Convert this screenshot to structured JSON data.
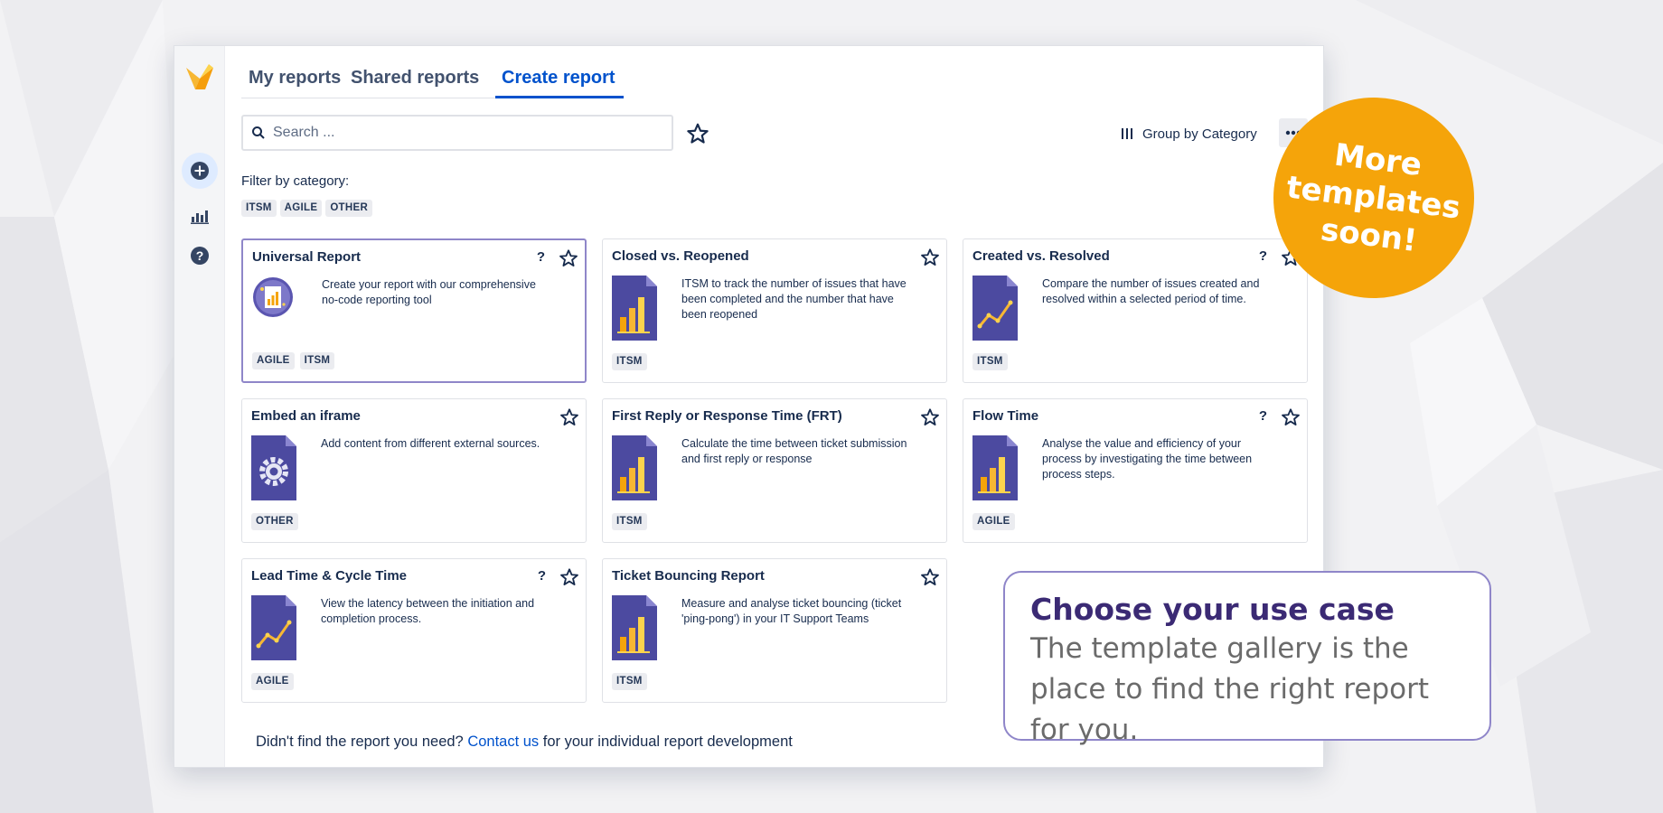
{
  "tabs": [
    {
      "label": "My reports",
      "active": false
    },
    {
      "label": "Shared reports",
      "active": false
    },
    {
      "label": "Create report",
      "active": true
    }
  ],
  "search": {
    "placeholder": "Search ...",
    "value": ""
  },
  "toolbar": {
    "group_label": "Group by Category",
    "more_icon": "more-icon"
  },
  "filter": {
    "label": "Filter by category:",
    "tags": [
      "ITSM",
      "AGILE",
      "OTHER"
    ]
  },
  "cards": [
    {
      "title": "Universal Report",
      "help": "?",
      "description": "Create your report with our comprehensive no-code reporting tool",
      "tags": [
        "AGILE",
        "ITSM"
      ],
      "icon": "universal-report-icon"
    },
    {
      "title": "Closed vs. Reopened",
      "help": "",
      "description": "ITSM to track the number of issues that have been completed and the number that have been reopened",
      "tags": [
        "ITSM"
      ],
      "icon": "bar-chart-doc-icon"
    },
    {
      "title": "Created vs. Resolved",
      "help": "?",
      "description": "Compare the number of issues created and resolved within a selected period of time.",
      "tags": [
        "ITSM"
      ],
      "icon": "line-chart-doc-icon"
    },
    {
      "title": "Embed an iframe",
      "help": "",
      "description": "Add content from different external sources.",
      "tags": [
        "OTHER"
      ],
      "icon": "gear-doc-icon"
    },
    {
      "title": "First Reply or Response Time (FRT)",
      "help": "",
      "description": "Calculate the time between ticket submission and first reply or response",
      "tags": [
        "ITSM"
      ],
      "icon": "bar-chart-doc-icon"
    },
    {
      "title": "Flow Time",
      "help": "?",
      "description": "Analyse the value and efficiency of your process by investigating the time between process steps.",
      "tags": [
        "AGILE"
      ],
      "icon": "bar-chart-doc-icon"
    },
    {
      "title": "Lead Time & Cycle Time",
      "help": "?",
      "description": "View the latency between the initiation and completion process.",
      "tags": [
        "AGILE"
      ],
      "icon": "line-chart-doc-icon"
    },
    {
      "title": "Ticket Bouncing Report",
      "help": "",
      "description": "Measure and analyse ticket bouncing (ticket 'ping-pong') in your IT Support Teams",
      "tags": [
        "ITSM"
      ],
      "icon": "bar-chart-doc-icon"
    }
  ],
  "footer": {
    "prefix": "Didn't find the report you need? ",
    "link": "Contact us",
    "suffix": " for your individual report development"
  },
  "promo": {
    "badge_lines": [
      "More",
      "templates",
      "soon!"
    ]
  },
  "callout": {
    "title": "Choose your use case",
    "body": "The template gallery is the place to find the right report for you."
  },
  "colors": {
    "accent": "#0052cc",
    "badge": "#f5a40a",
    "callout_title": "#3b2a74",
    "card_purple": "#4c4aa0"
  }
}
